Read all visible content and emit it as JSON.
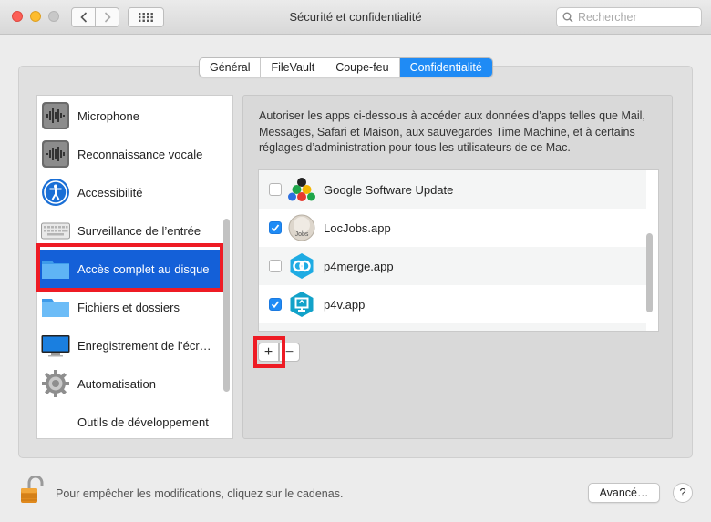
{
  "window": {
    "title": "Sécurité et confidentialité",
    "search_placeholder": "Rechercher"
  },
  "tabs": [
    {
      "label": "Général",
      "active": false
    },
    {
      "label": "FileVault",
      "active": false
    },
    {
      "label": "Coupe-feu",
      "active": false
    },
    {
      "label": "Confidentialité",
      "active": true
    }
  ],
  "sidebar": {
    "items": [
      {
        "label": "Microphone",
        "icon": "microphone-waveform-icon"
      },
      {
        "label": "Reconnaissance vocale",
        "icon": "speech-waveform-icon"
      },
      {
        "label": "Accessibilité",
        "icon": "accessibility-icon"
      },
      {
        "label": "Surveillance de l’entrée",
        "icon": "keyboard-icon"
      },
      {
        "label": "Accès complet au disque",
        "icon": "folder-icon",
        "selected": true
      },
      {
        "label": "Fichiers et dossiers",
        "icon": "folder-icon"
      },
      {
        "label": "Enregistrement de l’écr…",
        "icon": "display-icon"
      },
      {
        "label": "Automatisation",
        "icon": "gear-icon"
      },
      {
        "label": "Outils de développement",
        "icon": ""
      }
    ]
  },
  "description": "Autoriser les apps ci-dessous à accéder aux données d’apps telles que Mail, Messages, Safari et Maison, aux sauvegardes Time Machine, et à certains réglages d’administration pour tous les utilisateurs de ce Mac.",
  "apps": [
    {
      "name": "Google Software Update",
      "checked": false,
      "icon": "google-update-icon"
    },
    {
      "name": "LocJobs.app",
      "checked": true,
      "icon": "locjobs-icon",
      "icon_text": "Jobs"
    },
    {
      "name": "p4merge.app",
      "checked": false,
      "icon": "p4merge-icon"
    },
    {
      "name": "p4v.app",
      "checked": true,
      "icon": "p4v-icon"
    }
  ],
  "buttons": {
    "add": "+",
    "remove": "−",
    "advanced": "Avancé…",
    "help": "?"
  },
  "footer": {
    "lock_text": "Pour empêcher les modifications, cliquez sur le cadenas."
  },
  "colors": {
    "accent": "#1f8bf5",
    "selection": "#1460d8",
    "highlight_outline": "#ee1b24"
  }
}
